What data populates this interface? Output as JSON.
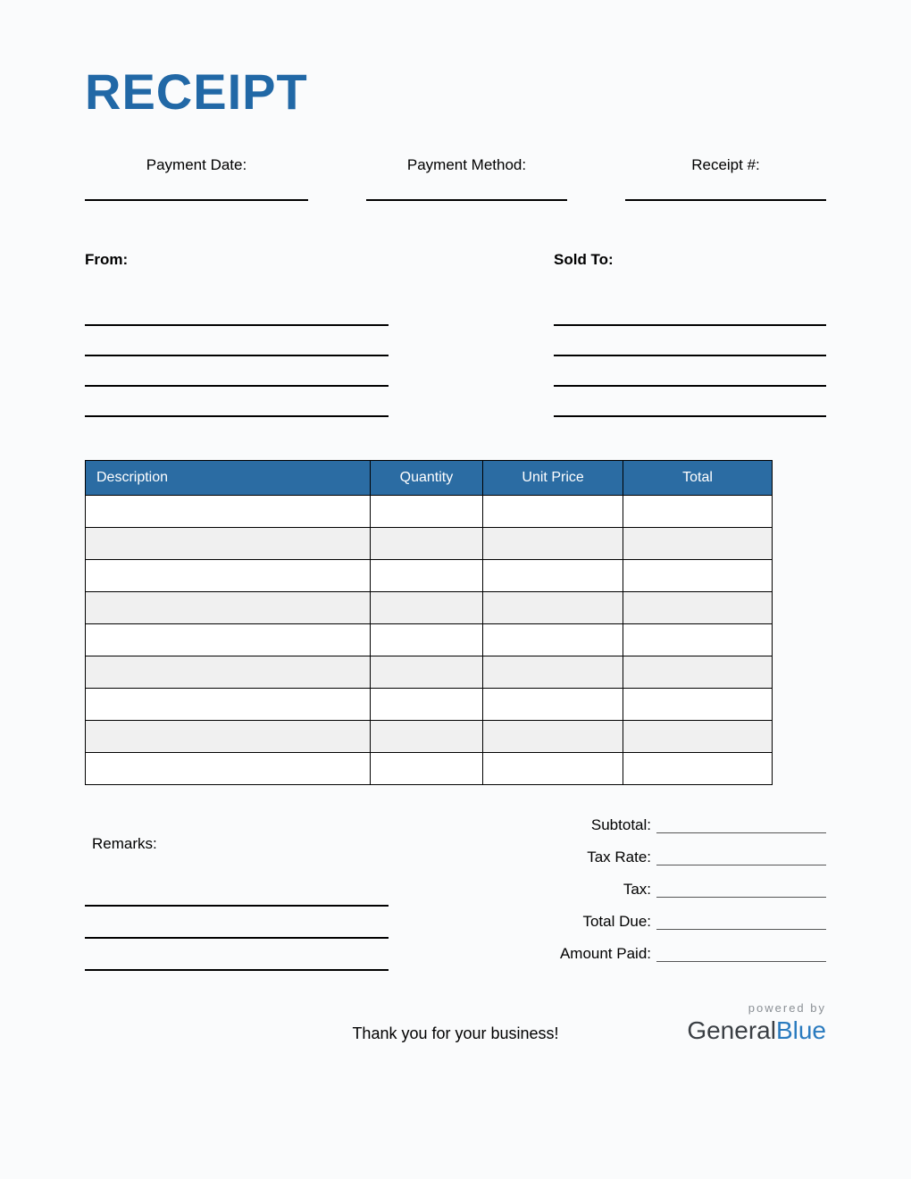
{
  "title": "RECEIPT",
  "meta": {
    "payment_date_label": "Payment Date:",
    "payment_method_label": "Payment Method:",
    "receipt_no_label": "Receipt #:"
  },
  "parties": {
    "from_label": "From:",
    "sold_to_label": "Sold To:"
  },
  "table": {
    "headers": {
      "description": "Description",
      "quantity": "Quantity",
      "unit_price": "Unit Price",
      "total": "Total"
    }
  },
  "remarks_label": "Remarks:",
  "totals": {
    "subtotal": "Subtotal:",
    "tax_rate": "Tax Rate:",
    "tax": "Tax:",
    "total_due": "Total Due:",
    "amount_paid": "Amount Paid:"
  },
  "footer": {
    "thanks": "Thank you for your business!",
    "powered_by": "powered by",
    "brand_general": "General",
    "brand_blue": "Blue"
  }
}
